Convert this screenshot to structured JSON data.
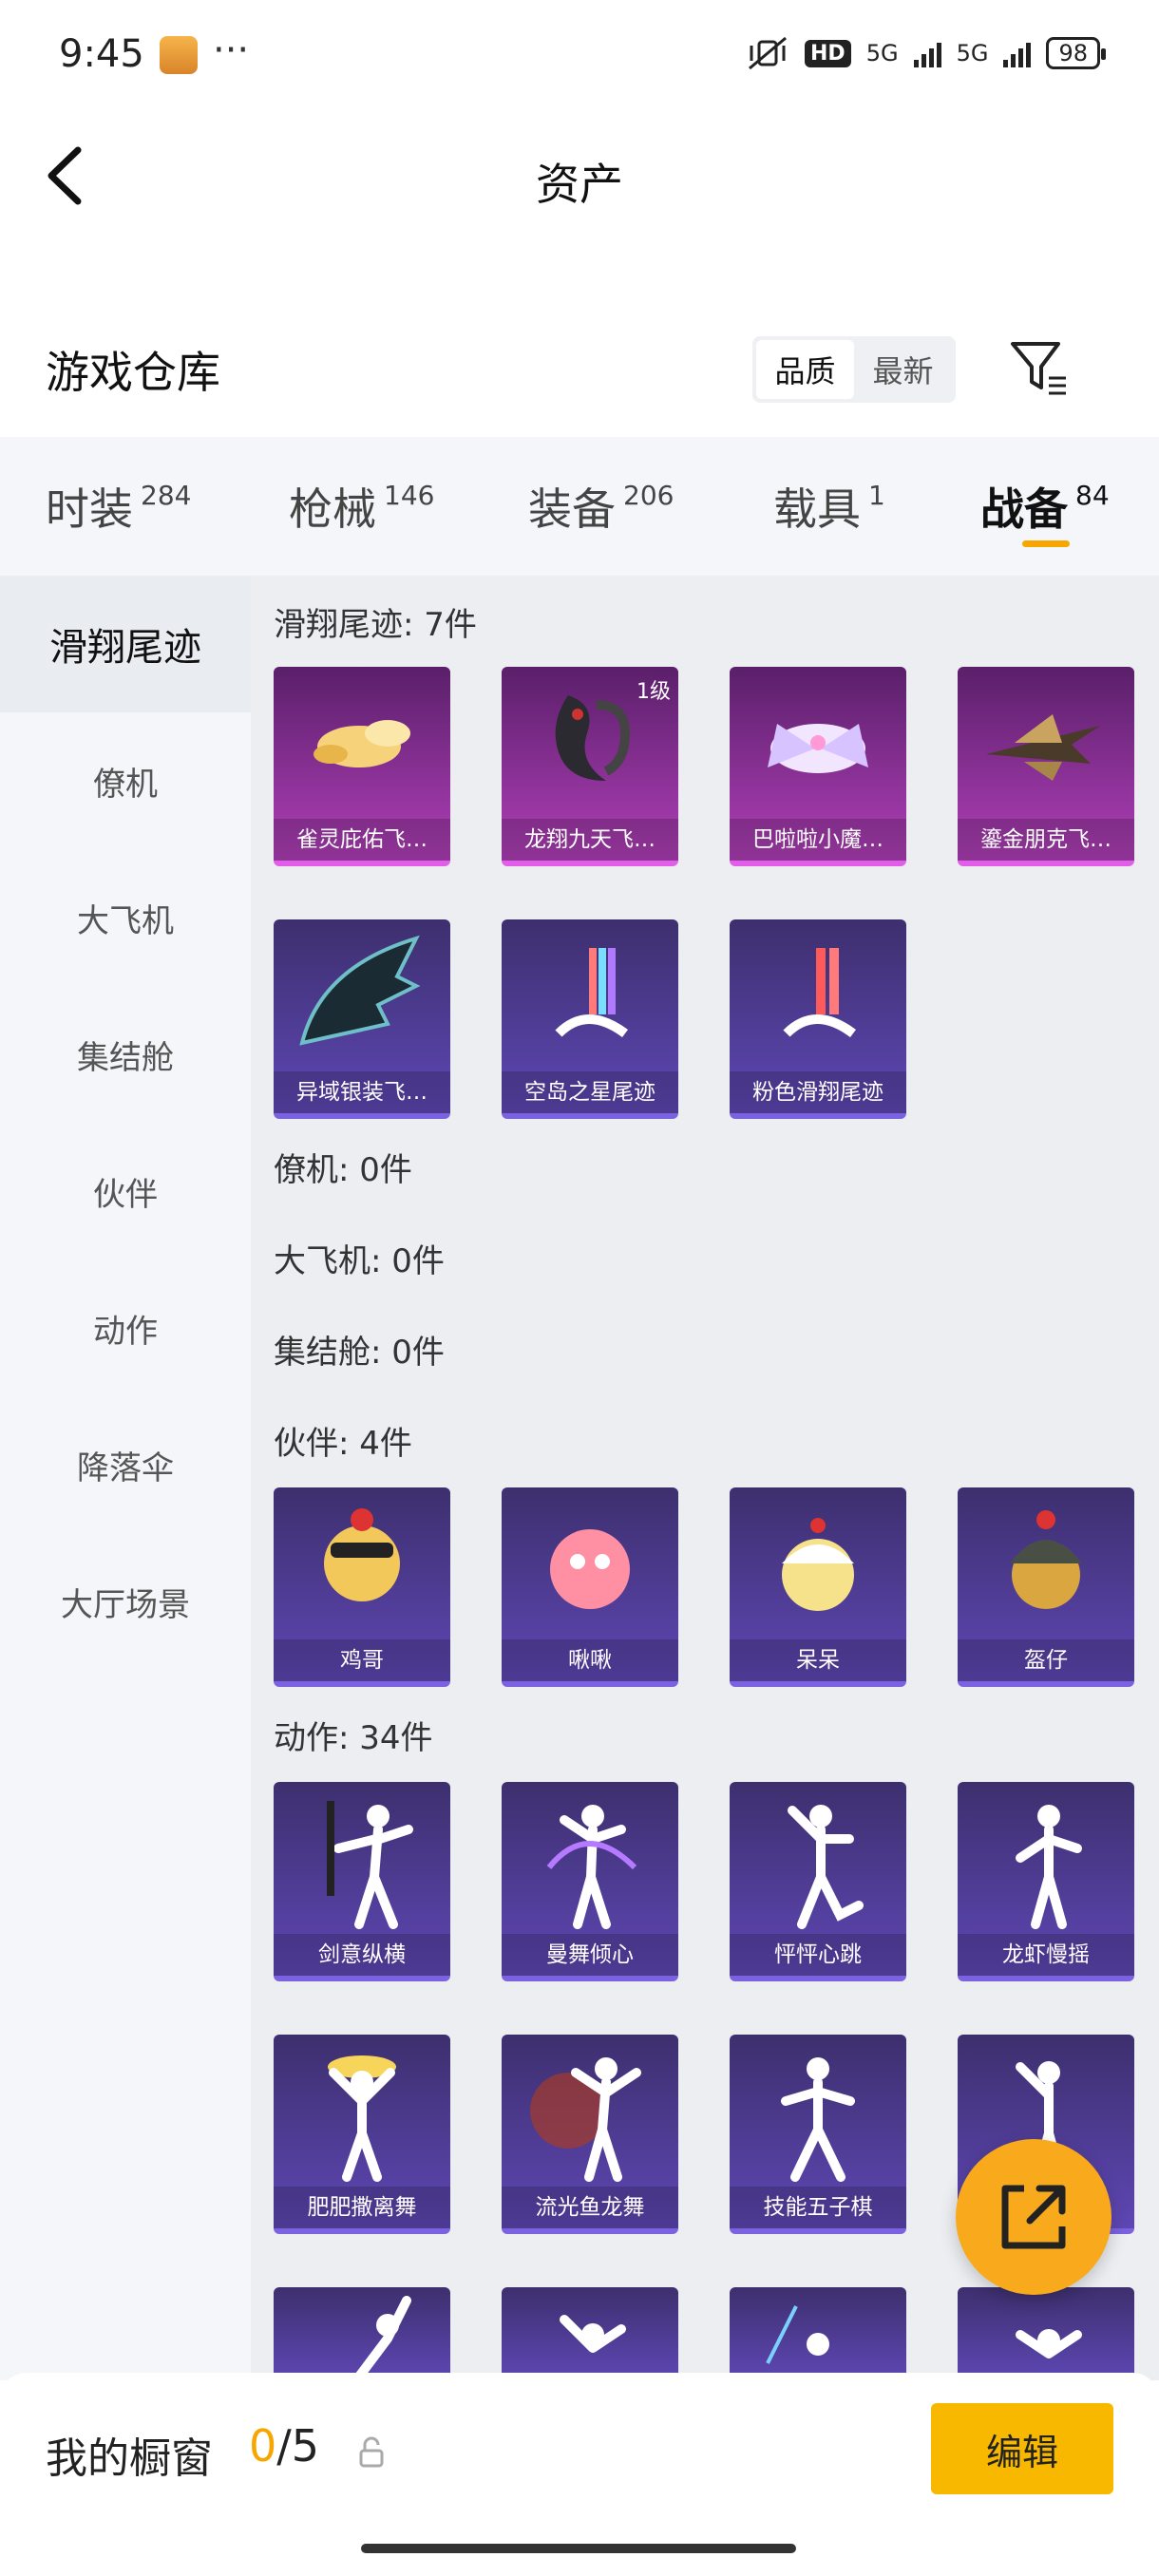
{
  "status": {
    "time": "9:45",
    "dots": "···",
    "network_badge": "HD",
    "net1": "5G",
    "net2": "5G",
    "battery": "98"
  },
  "header": {
    "title": "资产",
    "subtitle": "游戏仓库",
    "sort": [
      "品质",
      "最新"
    ],
    "active_sort": "品质"
  },
  "tabs": [
    {
      "label": "时装",
      "count": "284"
    },
    {
      "label": "枪械",
      "count": "146"
    },
    {
      "label": "装备",
      "count": "206"
    },
    {
      "label": "载具",
      "count": "1"
    },
    {
      "label": "战备",
      "count": "84"
    }
  ],
  "active_tab": "战备",
  "sidebar": [
    "滑翔尾迹",
    "僚机",
    "大飞机",
    "集结舱",
    "伙伴",
    "动作",
    "降落伞",
    "大厅场景"
  ],
  "sections": {
    "glide": {
      "title": "滑翔尾迹: 7件",
      "items": [
        "雀灵庇佑飞…",
        "龙翔九天飞…",
        "巴啦啦小魔…",
        "鎏金朋克飞…",
        "异域银装飞…",
        "空岛之星尾迹",
        "粉色滑翔尾迹"
      ],
      "badge": "1级"
    },
    "wingman": {
      "title": "僚机: 0件"
    },
    "plane": {
      "title": "大飞机: 0件"
    },
    "pod": {
      "title": "集结舱: 0件"
    },
    "partner": {
      "title": "伙伴: 4件",
      "items": [
        "鸡哥",
        "啾啾",
        "呆呆",
        "盔仔"
      ]
    },
    "emote": {
      "title": "动作: 34件",
      "items": [
        "剑意纵横",
        "曼舞倾心",
        "怦怦心跳",
        "龙虾慢摇",
        "肥肥撒离舞",
        "流光鱼龙舞",
        "技能五子棋"
      ]
    }
  },
  "bottom": {
    "label": "我的橱窗",
    "current": "0",
    "total": "/5",
    "edit": "编辑"
  },
  "colors": {
    "accent": "#f7a600",
    "card_purple": "#5e47b4",
    "card_pink": "#b03fb8"
  }
}
